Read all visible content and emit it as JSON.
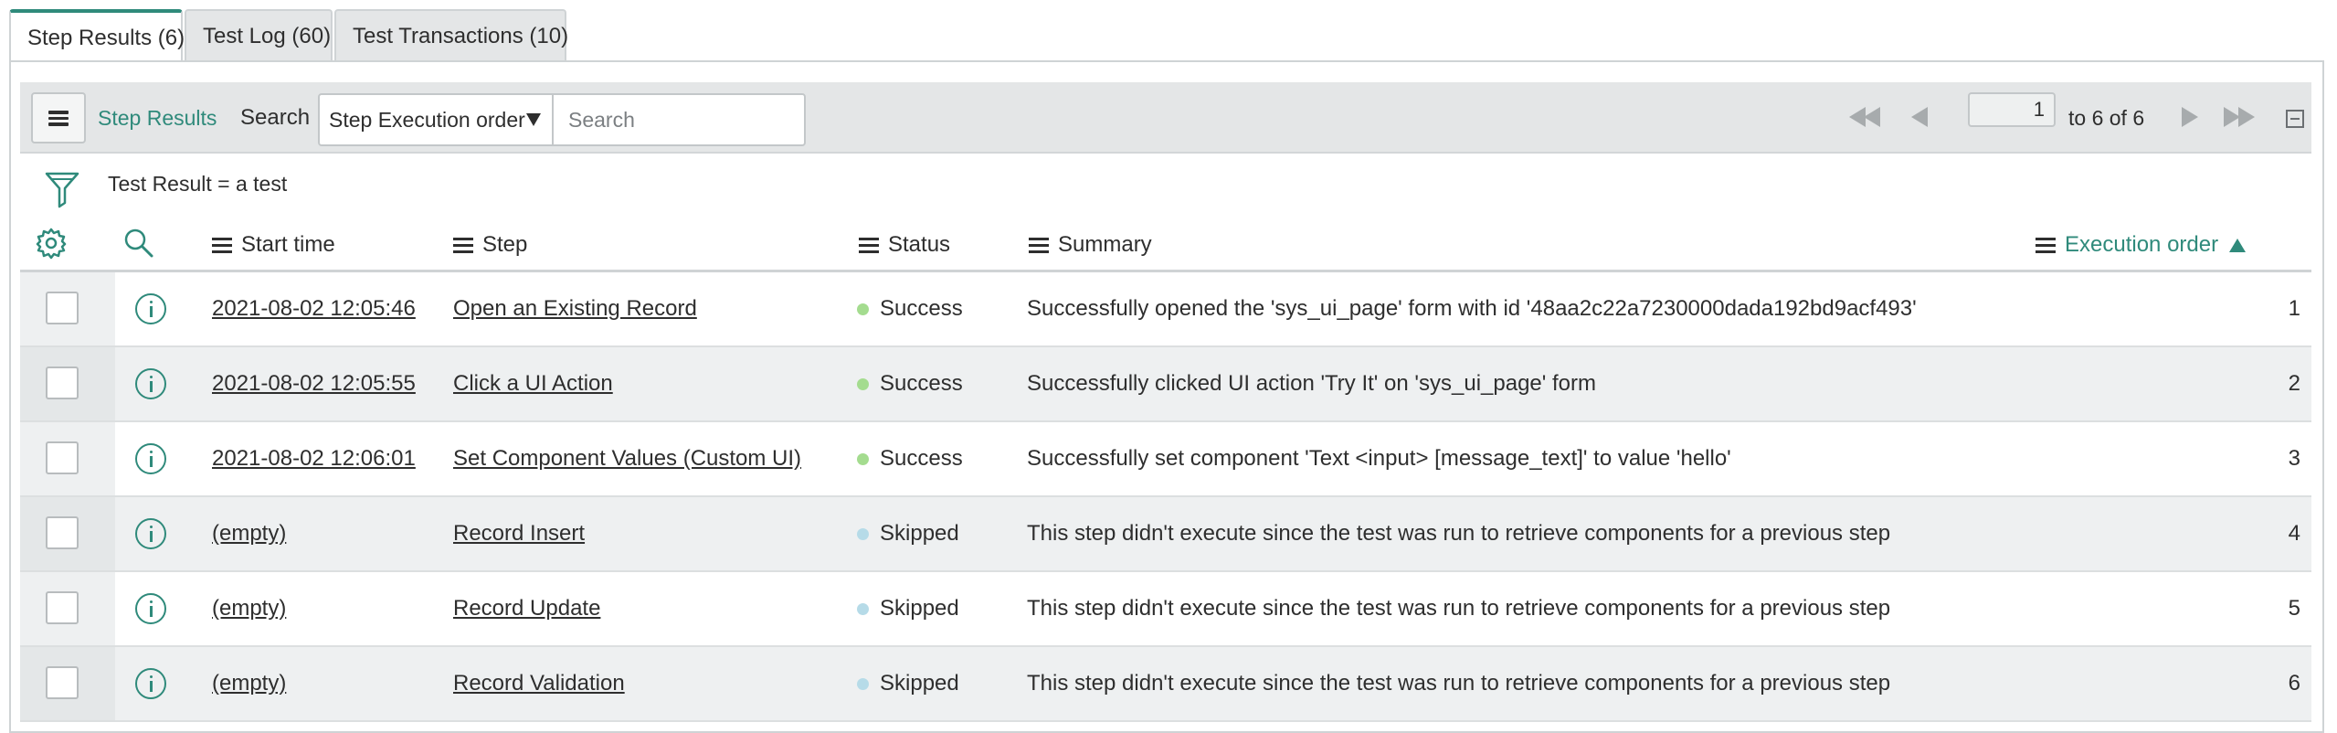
{
  "tabs": [
    {
      "label": "Step Results (6)",
      "active": true
    },
    {
      "label": "Test Log (60)",
      "active": false
    },
    {
      "label": "Test Transactions (10)",
      "active": false
    }
  ],
  "toolbar": {
    "menu_icon": "hamburger-icon",
    "list_title": "Step Results",
    "search_label": "Search",
    "search_field_selected": "Step Execution order",
    "search_placeholder": "Search",
    "pagination": {
      "current_page": "1",
      "range_text": "to 6 of 6"
    }
  },
  "filter": {
    "icon": "filter-funnel-icon",
    "text": "Test Result = a test"
  },
  "columns": {
    "start_time": "Start time",
    "step": "Step",
    "status": "Status",
    "summary": "Summary",
    "execution_order": "Execution order"
  },
  "colors": {
    "accent": "#2f8a7b",
    "success": "#a4dc8f",
    "skipped": "#b6dbe8"
  },
  "rows": [
    {
      "start_time": "2021-08-02 12:05:46",
      "step": "Open an Existing Record",
      "status": "Success",
      "summary": "Successfully opened the 'sys_ui_page' form with id '48aa2c22a7230000dada192bd9acf493'",
      "order": "1"
    },
    {
      "start_time": "2021-08-02 12:05:55",
      "step": "Click a UI Action",
      "status": "Success",
      "summary": "Successfully clicked UI action 'Try It' on 'sys_ui_page' form",
      "order": "2"
    },
    {
      "start_time": "2021-08-02 12:06:01",
      "step": "Set Component Values (Custom UI)",
      "status": "Success",
      "summary": "Successfully set component 'Text <input> [message_text]' to value 'hello'",
      "order": "3"
    },
    {
      "start_time": "(empty)",
      "step": "Record Insert",
      "status": "Skipped",
      "summary": "This step didn't execute since the test was run to retrieve components for a previous step",
      "order": "4"
    },
    {
      "start_time": "(empty)",
      "step": "Record Update",
      "status": "Skipped",
      "summary": "This step didn't execute since the test was run to retrieve components for a previous step",
      "order": "5"
    },
    {
      "start_time": "(empty)",
      "step": "Record Validation",
      "status": "Skipped",
      "summary": "This step didn't execute since the test was run to retrieve components for a previous step",
      "order": "6"
    }
  ]
}
